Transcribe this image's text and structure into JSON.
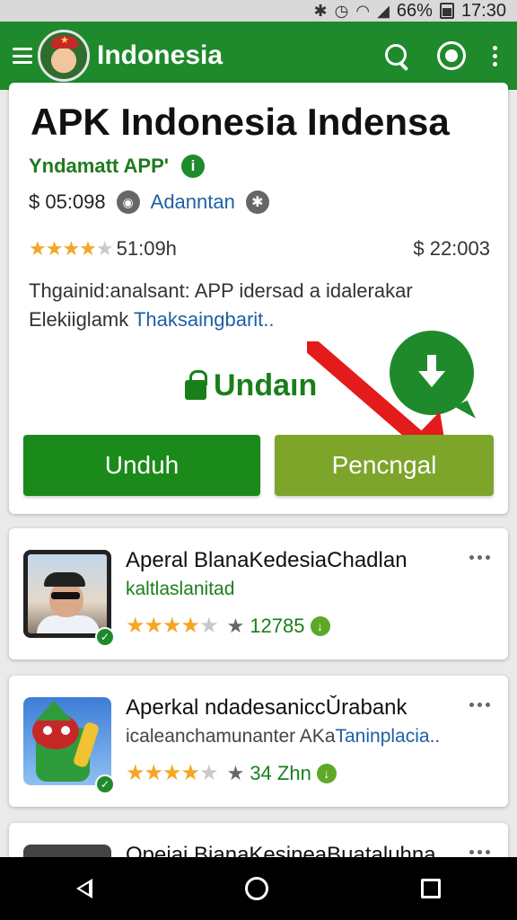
{
  "status_bar": {
    "battery": "66%",
    "time": "17:30",
    "icons": [
      "bluetooth-icon",
      "alarm-icon",
      "wifi-icon",
      "signal-icon",
      "battery-icon"
    ]
  },
  "app_bar": {
    "title": "Indonesia",
    "icons": [
      "menu-icon",
      "app-logo",
      "search-icon",
      "account-icon",
      "more-vert-icon"
    ]
  },
  "main_card": {
    "title": "APK Indonesia Indensa",
    "developer": "Yndamatt APP'",
    "info_icon": "i",
    "meta_price": "$ 05:098",
    "meta_link": "Adanntan",
    "rating_text": "51:09h",
    "price_right": "$ 22:003",
    "stars": 4,
    "description": "Thgainid:analsant: APP idersad a idalerakar Elekiiglamk",
    "description_link": "Thaksaingbarit..",
    "unduh_label": "Undaın",
    "btn_primary": "Unduh",
    "btn_secondary": "Pencngal",
    "accent_color": "#1f8a2b",
    "arrow_color": "#e31b1b"
  },
  "list": [
    {
      "title": "Aperal BlanaKedesiaChadlan",
      "subtitle": "kaltlaslanitad",
      "subtitle_link": "",
      "stars": 4,
      "count": "12785"
    },
    {
      "title": "Aperkal ndadesaniccǓrabank",
      "subtitle": "icaleanchamunanter AKa",
      "subtitle_link": "Taninplacia..",
      "stars": 4,
      "count": "34 Zhn"
    },
    {
      "title": "Opeiai BianaKesineaBuataluhna"
    }
  ],
  "nav_bar": {
    "icons": [
      "back-icon",
      "home-icon",
      "recents-icon"
    ]
  }
}
